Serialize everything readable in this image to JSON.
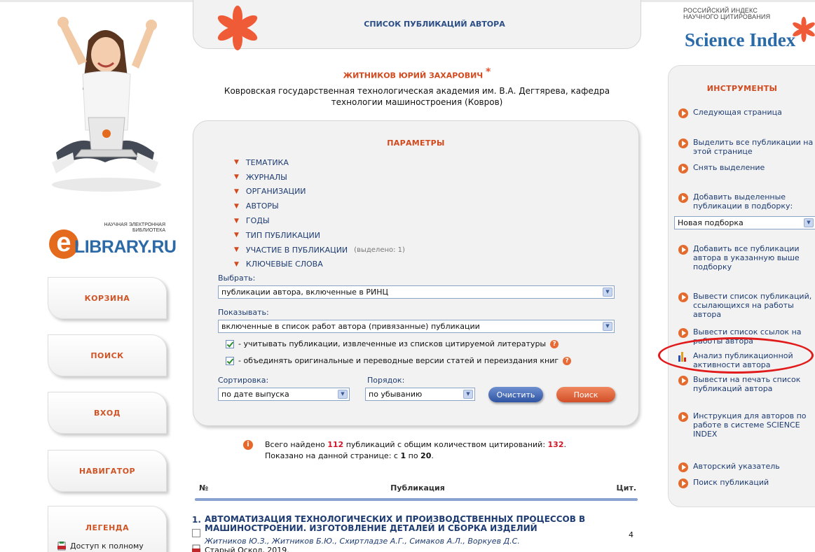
{
  "nav": {
    "cart": "КОРЗИНА",
    "search": "ПОИСК",
    "login": "ВХОД",
    "navigator": "НАВИГАТОР"
  },
  "legend": {
    "title": "ЛЕГЕНДА",
    "full_access": "Доступ к полному"
  },
  "logo": {
    "line1": "НАУЧНАЯ ЭЛЕКТРОННАЯ",
    "line2": "БИБЛИОТЕКА",
    "letter": "e",
    "name": "LIBRARY.RU"
  },
  "header": {
    "title": "СПИСОК ПУБЛИКАЦИЙ АВТОРА"
  },
  "author": {
    "name": "ЖИТНИКОВ ЮРИЙ ЗАХАРОВИЧ",
    "asterisk": "*",
    "org": "Ковровская государственная технологическая академия им. В.А. Дегтярева, кафедра технологии машиностроения (Ковров)"
  },
  "params": {
    "title": "ПАРАМЕТРЫ",
    "items": [
      "ТЕМАТИКА",
      "ЖУРНАЛЫ",
      "ОРГАНИЗАЦИИ",
      "АВТОРЫ",
      "ГОДЫ",
      "ТИП ПУБЛИКАЦИИ",
      "УЧАСТИЕ В ПУБЛИКАЦИИ",
      "КЛЮЧЕВЫЕ СЛОВА"
    ],
    "participation_note": "(выделено: 1)",
    "choose_label": "Выбрать:",
    "choose_value": "публикации автора, включенные в РИНЦ",
    "show_label": "Показывать:",
    "show_value": "включенные в список работ автора (привязанные) публикации",
    "check1": "- учитывать публикации, извлеченные из списков цитируемой литературы",
    "check2": "- объединять оригинальные и переводные версии статей и переиздания книг",
    "sort_label": "Сортировка:",
    "sort_value": "по дате выпуска",
    "order_label": "Порядок:",
    "order_value": "по убыванию",
    "clear_button": "Очистить",
    "search_button": "Поиск"
  },
  "results": {
    "line1_prefix": "Всего найдено",
    "total": "112",
    "line1_middle": "публикаций с общим количеством цитирований:",
    "citations": "132",
    "line2_prefix": "Показано на данной странице: с",
    "from": "1",
    "line2_middle": "по",
    "to": "20"
  },
  "table": {
    "col_no": "№",
    "col_pub": "Публикация",
    "col_cit": "Цит.",
    "rows": [
      {
        "num": "1.",
        "title": "АВТОМАТИЗАЦИЯ ТЕХНОЛОГИЧЕСКИХ И ПРОИЗВОДСТВЕННЫХ ПРОЦЕССОВ В МАШИНОСТРОЕНИИ. ИЗГОТОВЛЕНИЕ ДЕТАЛЕЙ И СБОРКА ИЗДЕЛИЙ",
        "authors": "Житников Ю.З., Житников Б.Ю., Схиртладзе А.Г., Симаков А.Л., Воркуев Д.С.",
        "source": "Старый Оскол, 2019.",
        "cit": "4"
      }
    ]
  },
  "brand": {
    "line1": "РОССИЙСКИЙ ИНДЕКС",
    "line2": "НАУЧНОГО ЦИТИРОВАНИЯ",
    "name": "Science Index"
  },
  "tools": {
    "title": "ИНСТРУМЕНТЫ",
    "next_page": "Следующая страница",
    "select_all": "Выделить все публикации на этой странице",
    "deselect": "Снять выделение",
    "add_selected": "Добавить выделенные публикации в подборку:",
    "collection_value": "Новая подборка",
    "add_all": "Добавить все публикации автора в указанную выше подборку",
    "citing_list": "Вывести список публикаций, ссылающихся на работы автора",
    "refs_list": "Вывести список ссылок на работы автора",
    "analysis": "Анализ публикационной активности автора",
    "print_list": "Вывести на печать список публикаций автора",
    "instructions": "Инструкция для авторов по работе в системе SCIENCE INDEX",
    "author_index": "Авторский указатель",
    "pub_search": "Поиск публикаций"
  },
  "colors": {
    "accent_orange": "#d2491e",
    "link_blue": "#1e3c72",
    "highlight_red": "#e11a1a"
  }
}
